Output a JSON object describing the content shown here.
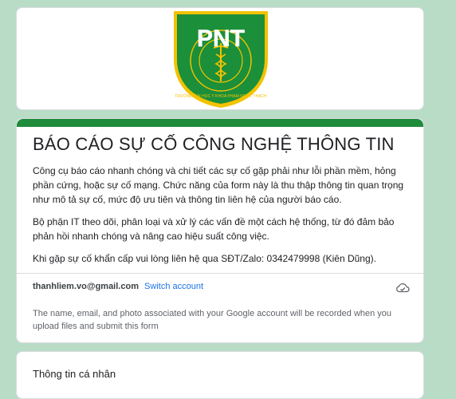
{
  "header": {
    "logo_alt": "PNT - Trường Đại học Y khoa Phạm Ngọc Thạch",
    "logo_text": "PNT",
    "logo_ring_text": "TRƯỜNG ĐẠI HỌC Y KHOA PHẠM NGỌC THẠCH"
  },
  "form": {
    "title": "BÁO CÁO SỰ CỐ CÔNG NGHỆ THÔNG TIN",
    "description": [
      "Công cụ báo cáo nhanh chóng và chi tiết các sự cố gặp phải như lỗi phần mềm, hỏng phần cứng, hoặc sự cố mạng. Chức năng của form này là thu thập thông tin quan trọng như mô tả sự cố, mức độ ưu tiên và thông tin liên hệ của người báo cáo.",
      "Bộ phận IT theo dõi, phân loại và xử lý các vấn đề một cách hệ thống, từ đó đảm bảo phản hồi nhanh chóng và nâng cao hiệu suất công việc.",
      "Khi gặp sự cố khẩn cấp vui lòng liên hệ qua SĐT/Zalo: 0342479998 (Kiên Dũng)."
    ]
  },
  "account": {
    "email": "thanhliem.vo@gmail.com",
    "switch_label": "Switch account",
    "notice": "The name, email, and photo associated with your Google account will be recorded when you upload files and submit this form"
  },
  "section": {
    "title": "Thông tin cá nhân"
  },
  "colors": {
    "page_bg": "#b9dcc6",
    "accent": "#1e8c3a",
    "logo_green": "#1b8f3a",
    "logo_gold": "#f2c200",
    "link": "#1a73e8"
  },
  "icons": {
    "cloud": "cloud-offline-icon"
  }
}
